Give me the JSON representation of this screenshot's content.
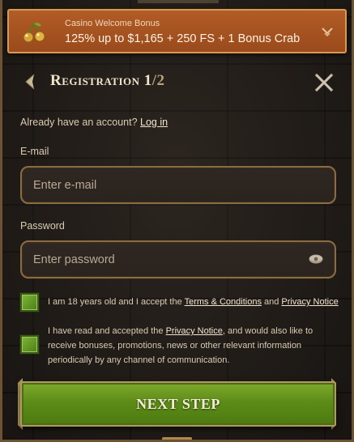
{
  "bonus": {
    "label": "Casino Welcome Bonus",
    "offer": "125% up to $1,165 + 250 FS + 1 Bonus Crab",
    "icon": "cherry-icon",
    "expand_icon": "chevron-down-icon"
  },
  "header": {
    "title": "Registration 1",
    "step_suffix": "/2",
    "back_icon": "arrow-left-icon",
    "close_icon": "close-icon"
  },
  "login_prompt": {
    "text": "Already have an account?",
    "link": "Log in"
  },
  "form": {
    "email_label": "E-mail",
    "email_placeholder": "Enter e-mail",
    "email_value": "",
    "password_label": "Password",
    "password_placeholder": "Enter password",
    "password_value": "",
    "password_toggle_icon": "eye-icon"
  },
  "consents": [
    {
      "checked": true,
      "text_before": "I am 18 years old and I accept the ",
      "link1": "Terms & Conditions",
      "text_mid": " and ",
      "link2": "Privacy Notice",
      "text_after": ""
    },
    {
      "checked": true,
      "text_before": "I have read and accepted the ",
      "link1": "Privacy Notice",
      "text_after": ", and would also like to receive bonuses, promotions, news or other relevant information periodically by any channel of communication."
    }
  ],
  "next_button": "NEXT STEP",
  "colors": {
    "bonus_bg": "#a9531f",
    "accent_green": "#5d8c18",
    "frame_gold": "#8c6b42",
    "background": "#241f1b"
  }
}
